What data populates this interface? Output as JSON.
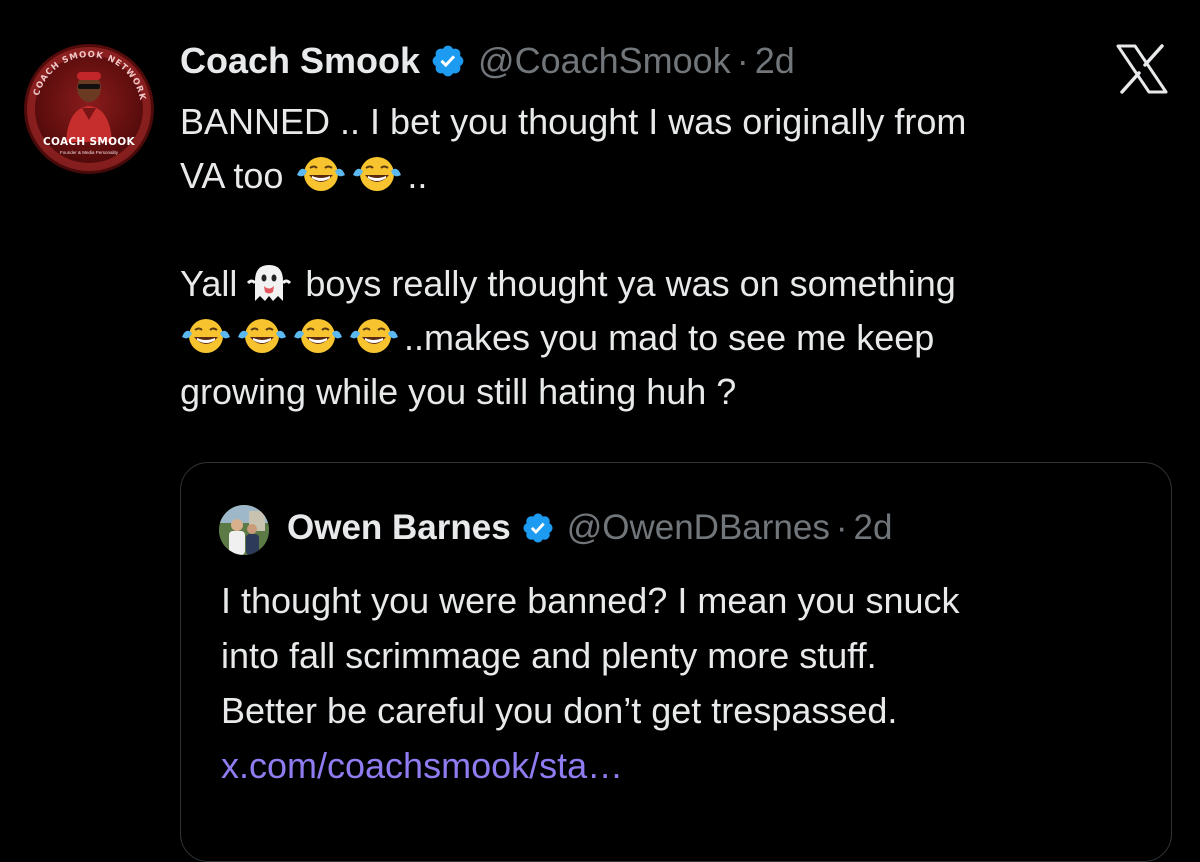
{
  "tweet": {
    "author": {
      "display_name": "Coach Smook",
      "handle": "@CoachSmook",
      "separator": "·",
      "time": "2d",
      "verified": true,
      "avatar": {
        "name_text": "COACH SMOOK",
        "subtitle_text": "Founder & Media Personality",
        "ring_text": "COACH SMOOK NETWORK"
      }
    },
    "platform_icon": "x-logo-icon",
    "lines": [
      {
        "text": "BANNED .. I bet you thought I was originally from"
      },
      {
        "before": "VA too",
        "after": ".."
      },
      {
        "before": "Yall",
        "after": "boys really thought ya was on something"
      },
      {
        "after": "..makes you mad to see me keep"
      },
      {
        "text": "growing while you still hating huh ?"
      }
    ],
    "emojis": {
      "laugh": "face-with-tears-of-joy-icon",
      "ghost": "ghost-icon"
    }
  },
  "quote": {
    "author": {
      "display_name": "Owen Barnes",
      "handle": "@OwenDBarnes",
      "separator": "·",
      "time": "2d",
      "verified": true
    },
    "lines": [
      "I thought you were banned? I mean you snuck",
      "into fall scrimmage and plenty more stuff.",
      "Better be careful you don’t get trespassed."
    ],
    "link": "x.com/coachsmook/sta…"
  },
  "colors": {
    "background": "#000000",
    "text": "#e7e9ea",
    "secondary": "#71767b",
    "verified": "#1d9bf0",
    "link": "#8e7cf0",
    "border": "#2f3336"
  }
}
